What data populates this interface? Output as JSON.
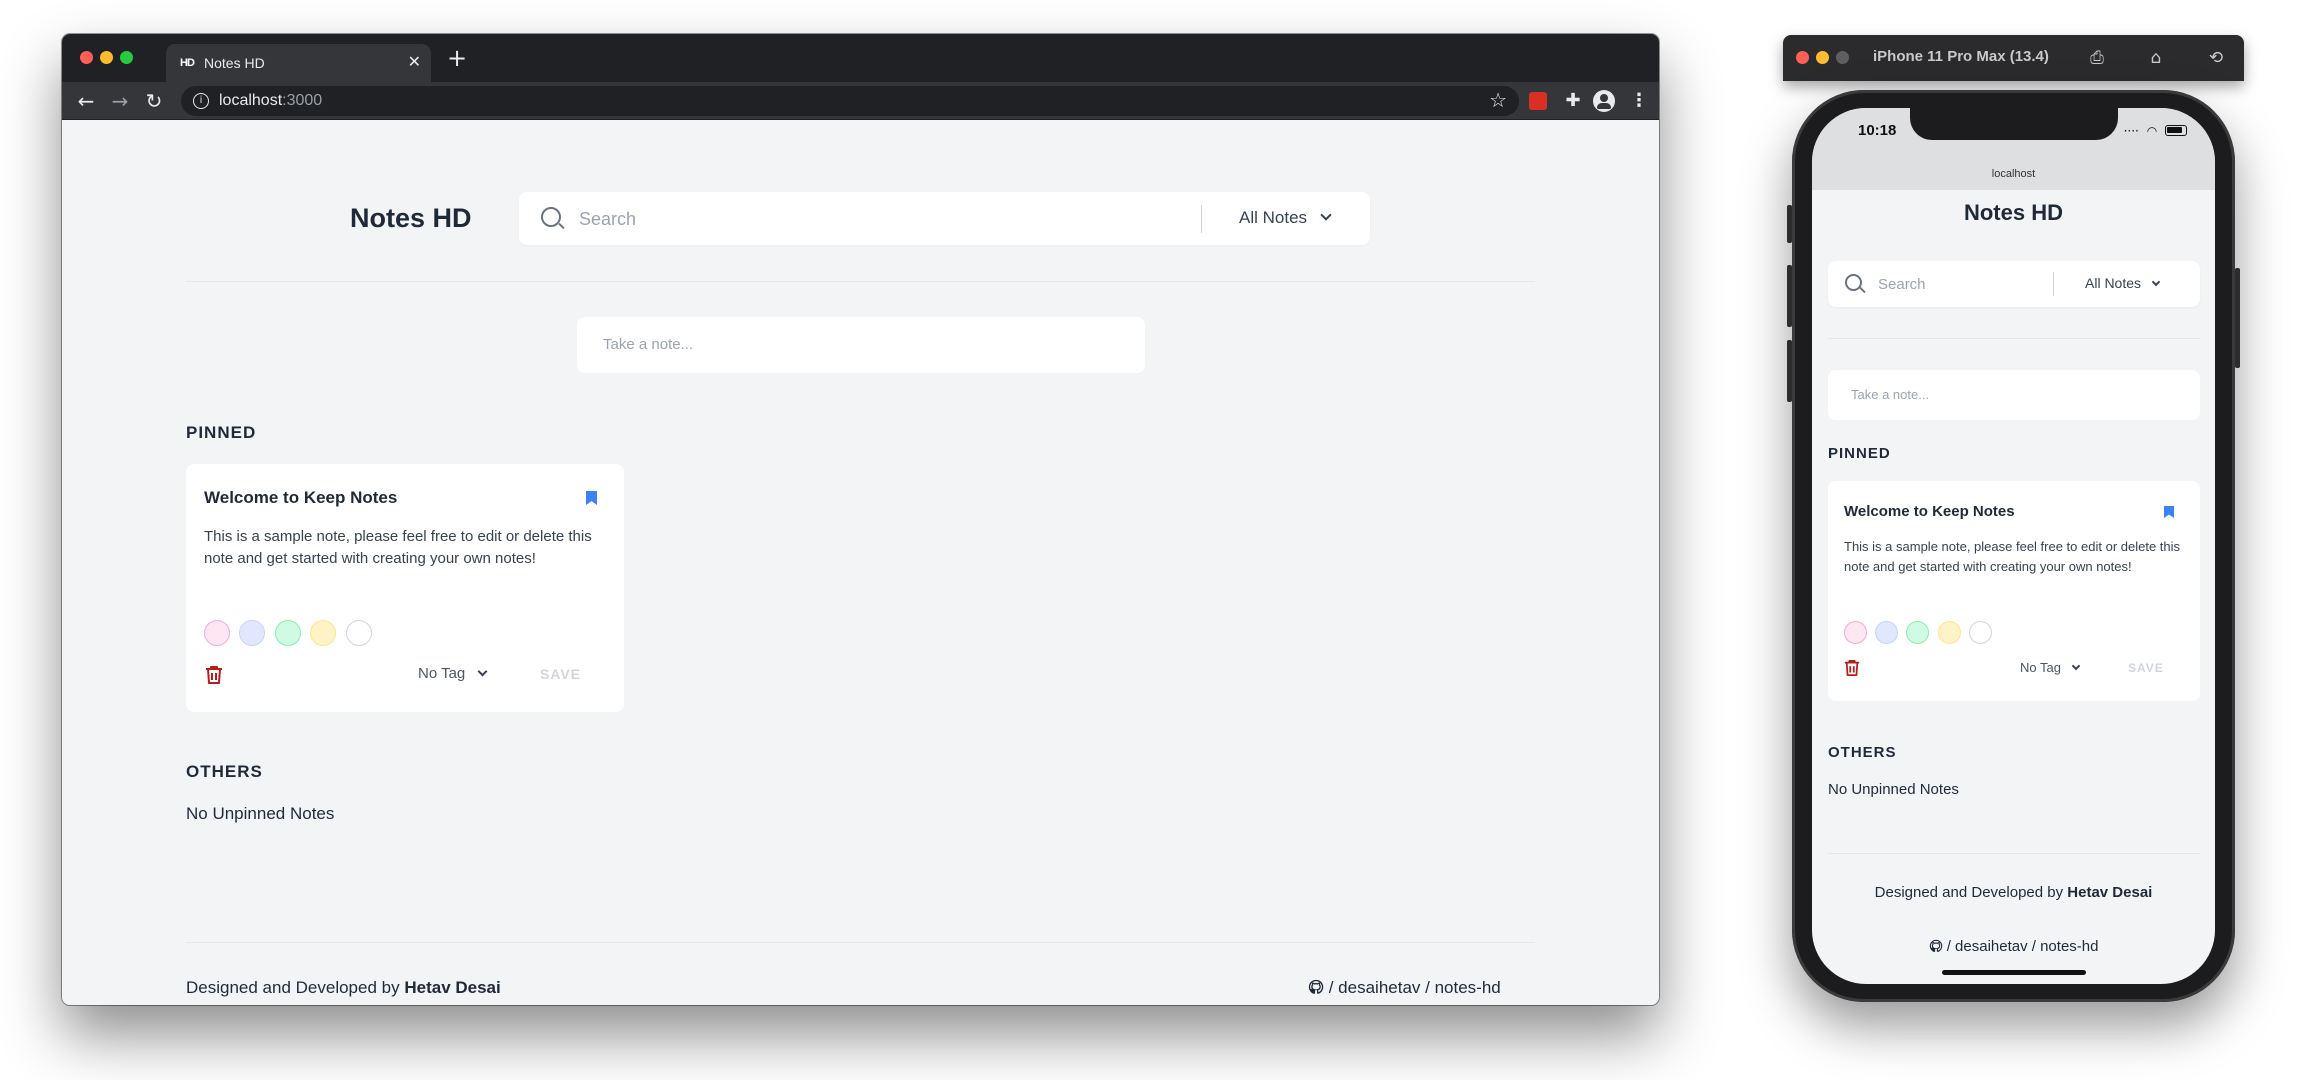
{
  "browser": {
    "tab_title": "Notes HD",
    "tab_favicon": "HD",
    "url_host": "localhost",
    "url_port": ":3000"
  },
  "app": {
    "title": "Notes HD",
    "search_placeholder": "Search",
    "filter_label": "All Notes",
    "take_note_placeholder": "Take a note...",
    "pinned_label": "PINNED",
    "others_label": "OTHERS",
    "no_unpinned": "No Unpinned Notes",
    "note": {
      "title": "Welcome to Keep Notes",
      "body": "This is a sample note, please feel free to edit or delete this note and get started with creating your own notes!",
      "tag_label": "No Tag",
      "save_label": "SAVE"
    },
    "swatch_colors": [
      "#fce7f3",
      "#e0e7ff",
      "#d1fae5",
      "#fef3c7",
      "#ffffff"
    ],
    "accent_color": "#3b82f6",
    "danger_color": "#b91c1c",
    "footer_credit_prefix": "Designed and Developed by",
    "footer_author": "Hetav Desai",
    "footer_repo": "/ desaihetav / notes-hd"
  },
  "simulator": {
    "device_title": "iPhone 11 Pro Max (13.4)",
    "time": "10:18",
    "url": "localhost"
  }
}
